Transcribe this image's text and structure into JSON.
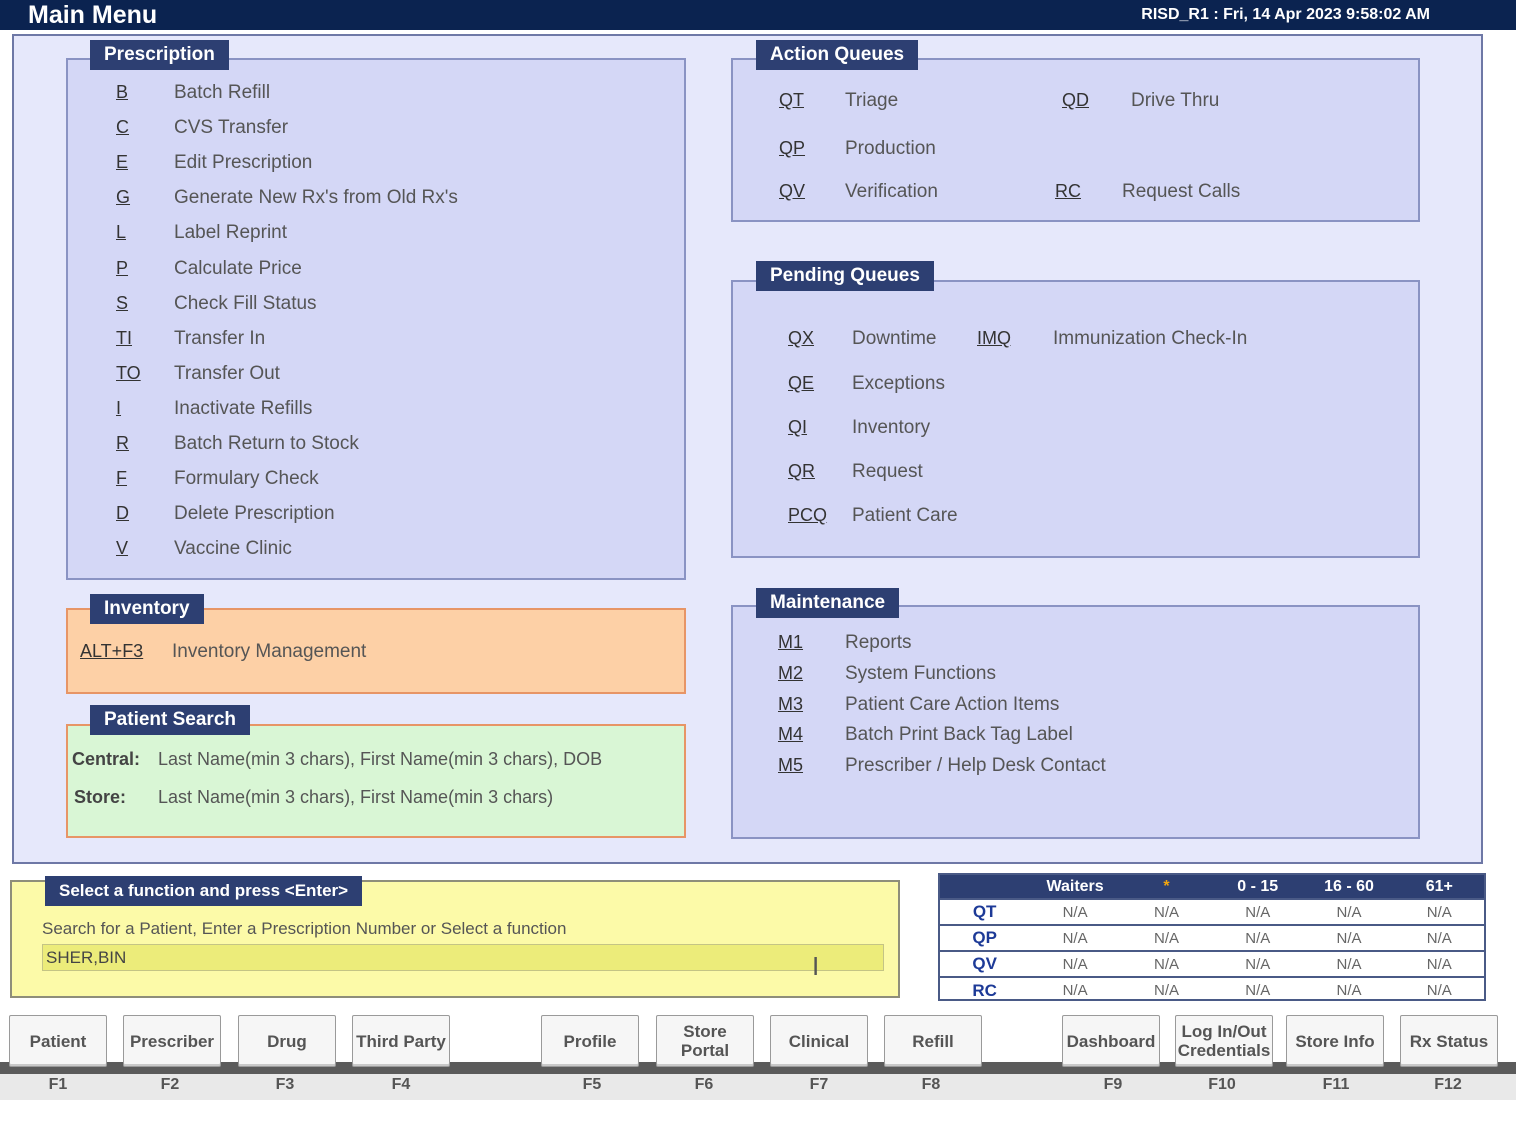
{
  "titlebar": {
    "title": "Main Menu",
    "status": "RISD_R1 : Fri, 14 Apr 2023 9:58:02 AM"
  },
  "prescription": {
    "header": "Prescription",
    "items": [
      {
        "key": "B",
        "label": "Batch Refill"
      },
      {
        "key": "C",
        "label": "CVS Transfer"
      },
      {
        "key": "E",
        "label": "Edit Prescription"
      },
      {
        "key": "G",
        "label": "Generate New Rx's from Old Rx's"
      },
      {
        "key": "L",
        "label": "Label Reprint"
      },
      {
        "key": "P",
        "label": "Calculate Price"
      },
      {
        "key": "S",
        "label": "Check Fill Status"
      },
      {
        "key": "TI",
        "label": "Transfer In"
      },
      {
        "key": "TO",
        "label": "Transfer Out"
      },
      {
        "key": "I",
        "label": "Inactivate Refills"
      },
      {
        "key": "R",
        "label": "Batch Return to Stock"
      },
      {
        "key": "F",
        "label": "Formulary Check"
      },
      {
        "key": "D",
        "label": "Delete Prescription"
      },
      {
        "key": "V",
        "label": "Vaccine Clinic"
      }
    ]
  },
  "inventory": {
    "header": "Inventory",
    "key": "ALT+F3",
    "label": "Inventory Management"
  },
  "patient_search": {
    "header": "Patient Search",
    "central_label": "Central:",
    "central_text": "Last Name(min 3 chars), First Name(min 3 chars), DOB",
    "store_label": "Store:",
    "store_text": "Last Name(min 3 chars), First Name(min 3 chars)"
  },
  "action_queues": {
    "header": "Action Queues",
    "qt": {
      "key": "QT",
      "label": "Triage"
    },
    "qd": {
      "key": "QD",
      "label": "Drive Thru"
    },
    "qp": {
      "key": "QP",
      "label": "Production"
    },
    "qv": {
      "key": "QV",
      "label": "Verification"
    },
    "rc": {
      "key": "RC",
      "label": "Request Calls"
    }
  },
  "pending_queues": {
    "header": "Pending Queues",
    "qx": {
      "key": "QX",
      "label": "Downtime"
    },
    "imq": {
      "key": "IMQ",
      "label": "Immunization Check-In"
    },
    "qe": {
      "key": "QE",
      "label": "Exceptions"
    },
    "qi": {
      "key": "QI",
      "label": "Inventory"
    },
    "qr": {
      "key": "QR",
      "label": "Request"
    },
    "pcq": {
      "key": "PCQ",
      "label": "Patient Care"
    }
  },
  "maintenance": {
    "header": "Maintenance",
    "items": [
      {
        "key": "M1",
        "label": "Reports"
      },
      {
        "key": "M2",
        "label": "System Functions"
      },
      {
        "key": "M3",
        "label": "Patient Care Action Items"
      },
      {
        "key": "M4",
        "label": "Batch Print Back Tag Label"
      },
      {
        "key": "M5",
        "label": "Prescriber / Help Desk Contact"
      }
    ]
  },
  "command": {
    "header": "Select a function and press <Enter>",
    "instructions": "Search for a Patient, Enter a Prescription Number or Select a function",
    "input_value": "SHER,BIN"
  },
  "waiters": {
    "headers": [
      "",
      "Waiters",
      "*",
      "0 - 15",
      "16 - 60",
      "61+"
    ],
    "rows": [
      {
        "q": "QT",
        "cells": [
          "N/A",
          "N/A",
          "N/A",
          "N/A",
          "N/A"
        ]
      },
      {
        "q": "QP",
        "cells": [
          "N/A",
          "N/A",
          "N/A",
          "N/A",
          "N/A"
        ]
      },
      {
        "q": "QV",
        "cells": [
          "N/A",
          "N/A",
          "N/A",
          "N/A",
          "N/A"
        ]
      },
      {
        "q": "RC",
        "cells": [
          "N/A",
          "N/A",
          "N/A",
          "N/A",
          "N/A"
        ]
      }
    ]
  },
  "fkeys": {
    "f1": {
      "label": "Patient",
      "key": "F1"
    },
    "f2": {
      "label": "Prescriber",
      "key": "F2"
    },
    "f3": {
      "label": "Drug",
      "key": "F3"
    },
    "f4": {
      "label": "Third Party",
      "key": "F4"
    },
    "f5": {
      "label": "Profile",
      "key": "F5"
    },
    "f6": {
      "label": "Store Portal",
      "key": "F6"
    },
    "f7": {
      "label": "Clinical",
      "key": "F7"
    },
    "f8": {
      "label": "Refill",
      "key": "F8"
    },
    "f9": {
      "label": "Dashboard",
      "key": "F9"
    },
    "f10": {
      "label": "Log In/Out Credentials",
      "key": "F10"
    },
    "f11": {
      "label": "Store Info",
      "key": "F11"
    },
    "f12": {
      "label": "Rx Status",
      "key": "F12"
    }
  }
}
